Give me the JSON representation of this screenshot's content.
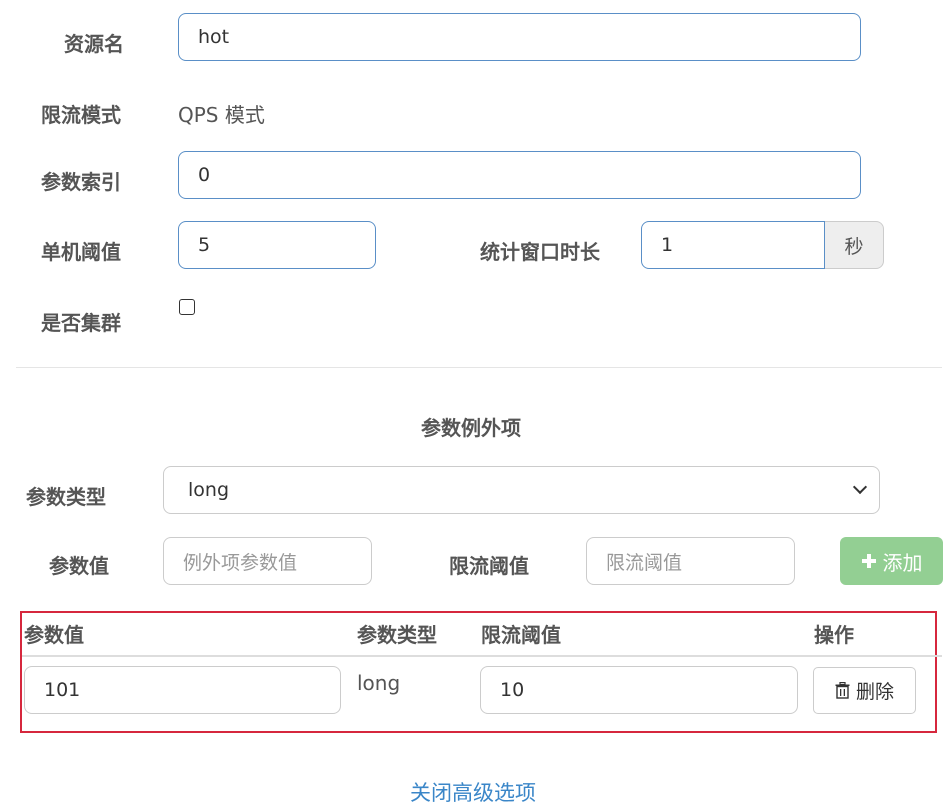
{
  "form": {
    "resource_name": {
      "label": "资源名",
      "value": "hot"
    },
    "limit_mode": {
      "label": "限流模式",
      "value": "QPS 模式"
    },
    "param_index": {
      "label": "参数索引",
      "value": "0"
    },
    "single_threshold": {
      "label": "单机阈值",
      "value": "5"
    },
    "stat_window": {
      "label": "统计窗口时长",
      "value": "1",
      "unit": "秒"
    },
    "cluster": {
      "label": "是否集群",
      "checked": false
    }
  },
  "exceptions": {
    "section_title": "参数例外项",
    "param_type": {
      "label": "参数类型",
      "selected": "long"
    },
    "param_value": {
      "label": "参数值",
      "placeholder": "例外项参数值"
    },
    "limit_threshold": {
      "label": "限流阈值",
      "placeholder": "限流阈值"
    },
    "add_button": {
      "icon": "plus-icon",
      "label": "添加"
    },
    "table": {
      "headers": [
        "参数值",
        "参数类型",
        "限流阈值",
        "操作"
      ],
      "rows": [
        {
          "value": "101",
          "type": "long",
          "threshold": "10",
          "action_label": "删除",
          "action_icon": "trash-icon"
        }
      ]
    }
  },
  "footer": {
    "toggle_link": "关闭高级选项"
  },
  "colors": {
    "highlight_border": "#d6273d",
    "add_button": "#93cf93",
    "link": "#3a86c8",
    "input_border": "#5a8fc7"
  }
}
